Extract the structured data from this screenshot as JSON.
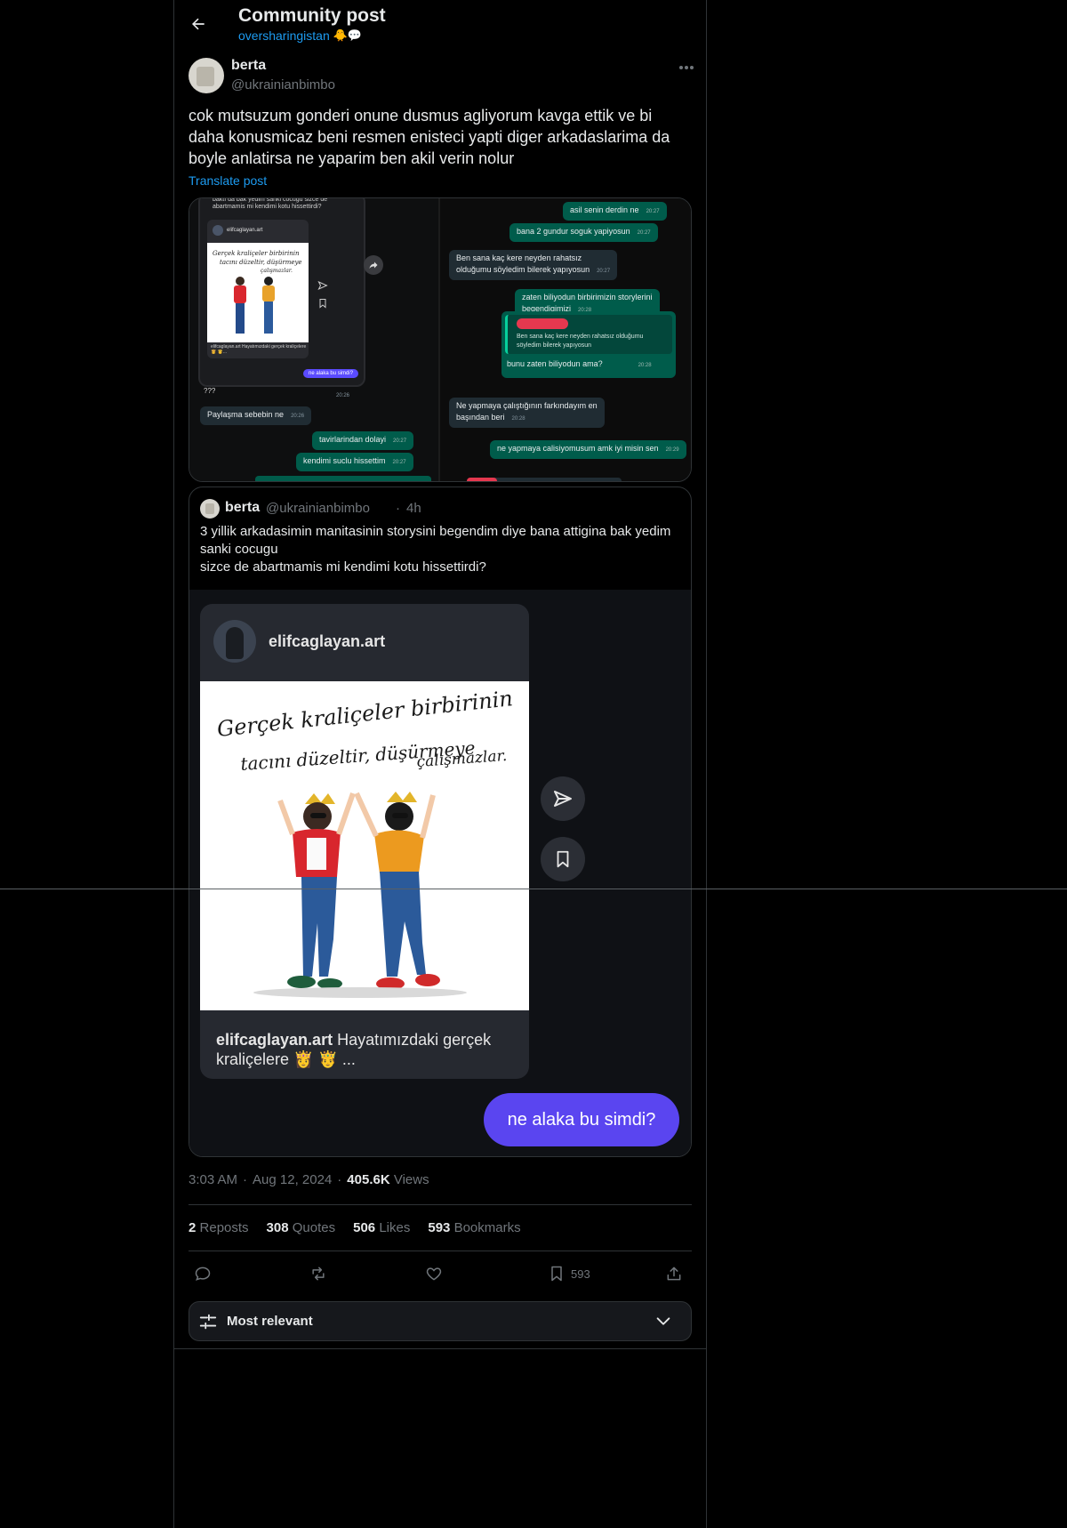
{
  "header": {
    "title": "Community post",
    "community": "oversharingistan",
    "community_emojis": "🐥💬"
  },
  "post": {
    "author_name": "berta",
    "author_handle": "@ukrainianbimbo",
    "text": "cok mutsuzum gonderi onune dusmus agliyorum kavga ettik ve bi daha konusmicaz beni resmen enisteci yapti diger arkadaslarima da boyle anlatirsa ne yaparim ben akil verin nolur",
    "translate_label": "Translate post"
  },
  "chat": {
    "phone_top": "baktı da bak yedim sanki cocugu sizce de abartmamis mi kendimi kotu hissettirdi?",
    "phone_user": "elifcaglayan.art",
    "phone_caption": "elifcaglayan.art Hayatımızdaki gerçek kraliçelere 👸 🤴...",
    "phone_bubble": "ne alaka bu simdi?",
    "phone_q": "???",
    "left_messages": [
      {
        "text": "Paylaşma sebebin ne",
        "time": "20:26"
      },
      {
        "text": "tavirlarindan dolayi",
        "time": "20:27"
      },
      {
        "text": "kendimi suclu hissettim",
        "time": "20:27"
      }
    ],
    "right_messages": [
      {
        "text": "asil senin derdin ne",
        "time": "20:27"
      },
      {
        "text": "bana 2 gundur soguk yapiyosun",
        "time": "20:27"
      },
      {
        "text": "Ben sana kaç kere neyden rahatsız\nolduğumu söyledim bilerek yapıyosun",
        "time": "20:27"
      },
      {
        "text": "zaten biliyodun birbirimizin storylerini\nbegendigimizi",
        "time": "20:28"
      },
      {
        "text": "Ne yapmaya çalıştığının farkındayım en\nbaşından beri",
        "time": "20:28"
      },
      {
        "text": "ne yapmaya calisiyomusum amk iyi misin sen",
        "time": "20:29"
      }
    ],
    "quoted_reply": {
      "quoted_text": "Ben sana kaç kere neyden rahatsız olduğumu\nsöyledim bilerek yapıyosun",
      "reply": "bunu zaten biliyodun ama?",
      "time": "20:28"
    },
    "phone_time": "20:26"
  },
  "quoted_post": {
    "author_name": "berta",
    "author_handle": "@ukrainianbimbo",
    "separator": "·",
    "time_ago": "4h",
    "text": "3 yillik arkadasimin manitasinin storysini begendim diye bana attigina bak yedim sanki cocugu\nsizce de abartmamis mi kendimi kotu hissettirdi?",
    "card_user": "elifcaglayan.art",
    "card_caption_user": "elifcaglayan.art",
    "card_caption_text": "Hayatımızdaki gerçek kraliçelere 👸 🤴 ...",
    "image_text_line1": "Gerçek kraliçeler birbirinin",
    "image_text_line2": "tacını düzeltir, düşürmeye",
    "image_text_line3": "çalışmazlar.",
    "reply_pill": "ne alaka bu simdi?"
  },
  "meta": {
    "time": "3:03 AM",
    "date": "Aug 12, 2024",
    "views_count": "405.6K",
    "views_label": "Views",
    "sep": "·"
  },
  "stats": {
    "reposts_count": "2",
    "reposts_label": "Reposts",
    "quotes_count": "308",
    "quotes_label": "Quotes",
    "likes_count": "506",
    "likes_label": "Likes",
    "bookmarks_count": "593",
    "bookmarks_label": "Bookmarks"
  },
  "actions": {
    "bookmark_count": "593"
  },
  "sort": {
    "label": "Most relevant"
  },
  "colors": {
    "background": "#000000",
    "accent": "#1d9bf0",
    "muted": "#71767b",
    "pill": "#5a45f0",
    "bubble_out": "#005c4b",
    "bubble_in": "#202c33"
  }
}
